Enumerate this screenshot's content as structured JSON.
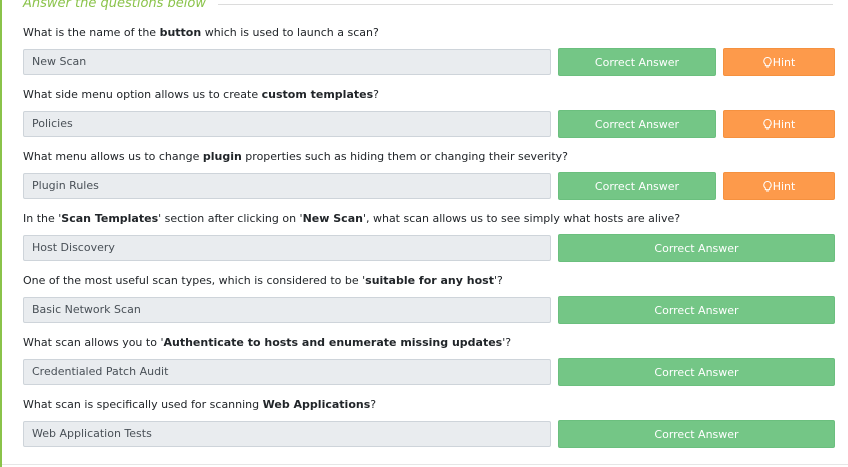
{
  "section": {
    "title": "Answer the questions below"
  },
  "questions": [
    {
      "parts": [
        "What is the name of the ",
        "button",
        " which is used to launch a scan?"
      ],
      "answer": "New Scan",
      "correct_label": "Correct Answer",
      "hint_label": "Hint"
    },
    {
      "parts": [
        "What side menu option allows us to create ",
        "custom templates",
        "?"
      ],
      "answer": "Policies",
      "correct_label": "Correct Answer",
      "hint_label": "Hint"
    },
    {
      "parts": [
        "What menu allows us to change ",
        "plugin",
        " properties such as hiding them or changing their severity?"
      ],
      "answer": "Plugin Rules",
      "correct_label": "Correct Answer",
      "hint_label": "Hint"
    },
    {
      "parts": [
        "In the '",
        "Scan Templates",
        "' section after clicking on '",
        "New Scan",
        "', what scan allows us to see simply what hosts are alive?"
      ],
      "answer": "Host Discovery",
      "correct_label": "Correct Answer"
    },
    {
      "parts": [
        "One of the most useful scan types, which is considered to be '",
        "suitable for any host",
        "'?"
      ],
      "answer": "Basic Network Scan",
      "correct_label": "Correct Answer"
    },
    {
      "parts": [
        "What scan allows you to '",
        "Authenticate to hosts and enumerate missing updates",
        "'?"
      ],
      "answer": "Credentialed Patch Audit",
      "correct_label": "Correct Answer"
    },
    {
      "parts": [
        "What scan is specifically used for scanning ",
        "Web Applications",
        "?"
      ],
      "answer": "Web Application Tests",
      "correct_label": "Correct Answer"
    }
  ],
  "icons": {
    "hint": "lightbulb-icon"
  },
  "colors": {
    "accent": "#8ac34a",
    "correct": "#74c686",
    "hint": "#fd9a4b",
    "field": "#e9ecef"
  }
}
